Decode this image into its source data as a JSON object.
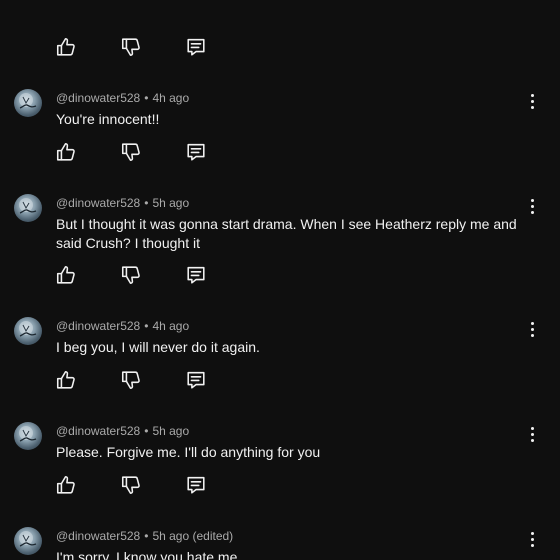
{
  "comments": [
    {
      "handle": "@dinowater528",
      "time": "4h ago",
      "text": "You're innocent!!"
    },
    {
      "handle": "@dinowater528",
      "time": "5h ago",
      "text": "But I thought it was gonna start drama. When I see Heatherz reply me and said Crush? I thought it"
    },
    {
      "handle": "@dinowater528",
      "time": "4h ago",
      "text": "I beg you, I will never do it again."
    },
    {
      "handle": "@dinowater528",
      "time": "5h ago",
      "text": "Please. Forgive me. I'll do anything for you"
    },
    {
      "handle": "@dinowater528",
      "time": "5h ago (edited)",
      "text": "I'm sorry. I know you hate me"
    }
  ],
  "separator": "•",
  "icons": [
    "like-icon",
    "dislike-icon",
    "reply-icon",
    "more-vert-icon",
    "avatar"
  ]
}
